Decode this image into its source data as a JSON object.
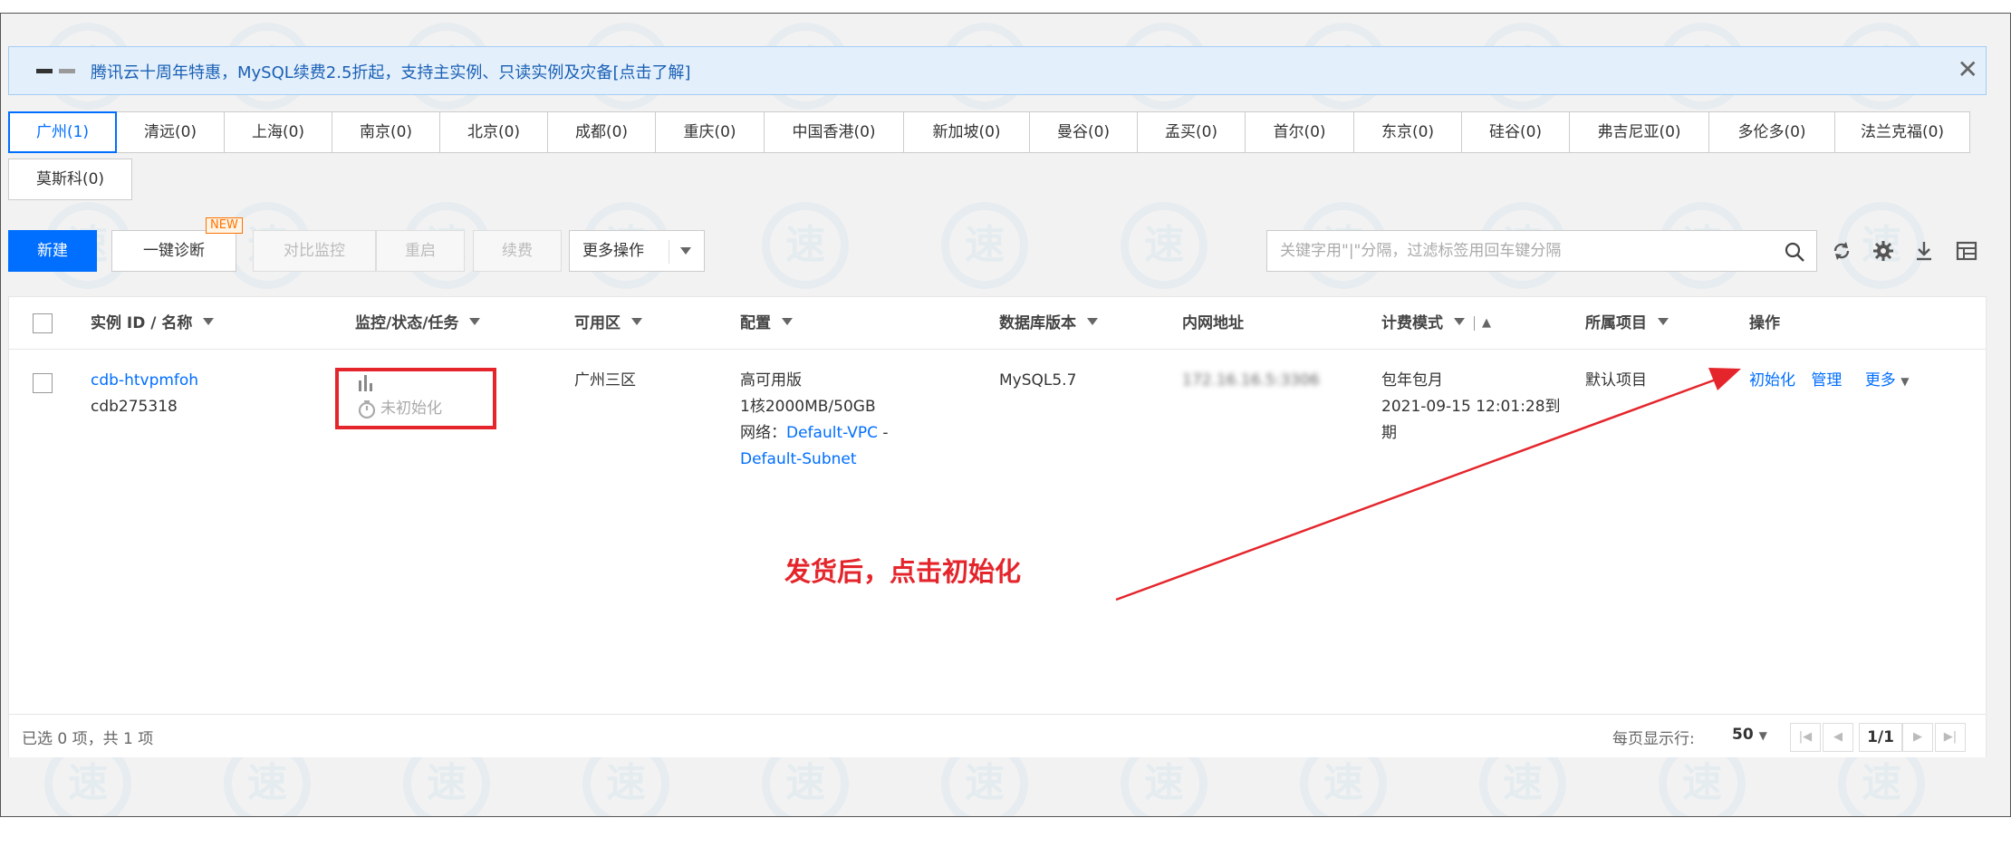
{
  "banner": {
    "text": "腾讯云十周年特惠，MySQL续费2.5折起，支持主实例、只读实例及灾备",
    "link": "[点击了解]"
  },
  "regions": [
    {
      "label": "广州(1)",
      "active": true
    },
    {
      "label": "清远(0)"
    },
    {
      "label": "上海(0)"
    },
    {
      "label": "南京(0)"
    },
    {
      "label": "北京(0)"
    },
    {
      "label": "成都(0)"
    },
    {
      "label": "重庆(0)"
    },
    {
      "label": "中国香港(0)"
    },
    {
      "label": "新加坡(0)"
    },
    {
      "label": "曼谷(0)"
    },
    {
      "label": "孟买(0)"
    },
    {
      "label": "首尔(0)"
    },
    {
      "label": "东京(0)"
    },
    {
      "label": "硅谷(0)"
    },
    {
      "label": "弗吉尼亚(0)"
    },
    {
      "label": "多伦多(0)"
    },
    {
      "label": "法兰克福(0)"
    },
    {
      "label": "莫斯科(0)"
    }
  ],
  "toolbar": {
    "new": "新建",
    "diagnose": "一键诊断",
    "new_badge": "NEW",
    "compare": "对比监控",
    "restart": "重启",
    "renew": "续费",
    "more_ops": "更多操作",
    "search_placeholder": "关键字用\"|\"分隔，过滤标签用回车键分隔"
  },
  "table": {
    "headers": {
      "id": "实例 ID / 名称",
      "status": "监控/状态/任务",
      "zone": "可用区",
      "config": "配置",
      "db_version": "数据库版本",
      "ip": "内网地址",
      "billing": "计费模式",
      "project": "所属项目",
      "ops": "操作"
    },
    "row": {
      "id": "cdb-htvpmfoh",
      "name": "cdb275318",
      "status": "未初始化",
      "zone": "广州三区",
      "config_edition": "高可用版",
      "config_spec": "1核2000MB/50GB",
      "network_label": "网络：",
      "vpc": "Default-VPC",
      "vpc_sep": "-",
      "subnet": "Default-Subnet",
      "db_version": "MySQL5.7",
      "ip": "172.16.16.5:3306",
      "billing_mode": "包年包月",
      "billing_expire": "2021-09-15 12:01:28到",
      "billing_expire_tail": "期",
      "project": "默认项目",
      "op_init": "初始化",
      "op_manage": "管理",
      "op_more": "更多"
    },
    "footer": {
      "selected": "已选 0 项，共 1 项",
      "per_page_label": "每页显示行:",
      "per_page": "50",
      "page": "1/1"
    }
  },
  "annotation": {
    "text": "发货后，点击初始化",
    "color": "#e4262c"
  },
  "colors": {
    "accent": "#006eff",
    "annotation_red": "#e4262c"
  }
}
